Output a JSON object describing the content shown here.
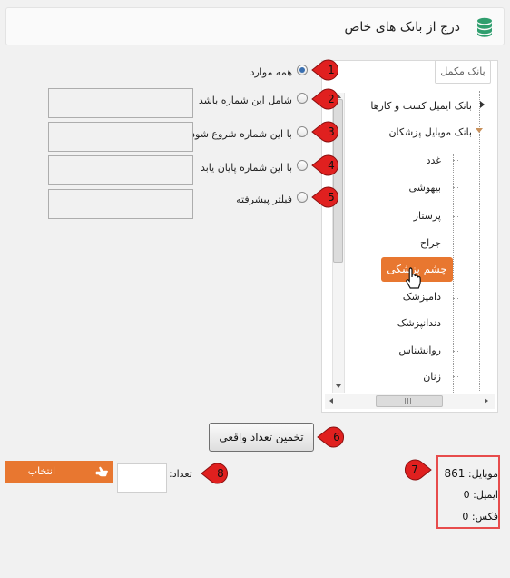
{
  "header": {
    "title": "درج از بانک های خاص",
    "icon": "database-icon"
  },
  "tree": {
    "legend": "بانک مکمل",
    "root_items": [
      {
        "label": "بانک ایمیل کسب و کارها",
        "expanded": false
      },
      {
        "label": "بانک موبایل پزشکان",
        "expanded": true
      }
    ],
    "children": [
      "غدد",
      "بیهوشی",
      "پرستار",
      "جراح",
      "چشم پزشکی",
      "دامپزشک",
      "دندانپزشک",
      "روانشناس",
      "زنان"
    ],
    "selected": "چشم پزشکی"
  },
  "options": [
    {
      "label": "همه موارد",
      "checked": true,
      "badge": "1"
    },
    {
      "label": "شامل این شماره باشد",
      "checked": false,
      "badge": "2"
    },
    {
      "label": "با این شماره شروع شود",
      "checked": false,
      "badge": "3"
    },
    {
      "label": "با این شماره پایان یابد",
      "checked": false,
      "badge": "4"
    },
    {
      "label": "فیلتر پیشرفته",
      "checked": false,
      "badge": "5"
    }
  ],
  "estimate": {
    "label": "تخمین تعداد واقعی",
    "badge": "6"
  },
  "results": {
    "badge": "7",
    "mobile_label": "موبایل:",
    "mobile_value": "861",
    "email_label": "ایمیل:",
    "email_value": "0",
    "fax_label": "فکس:",
    "fax_value": "0"
  },
  "count": {
    "label": "تعداد:",
    "badge": "8",
    "value": ""
  },
  "select_button": {
    "label": "انتخاب",
    "icon": "pointing-hand-icon"
  },
  "colors": {
    "accent": "#e87730",
    "badge_red": "#e0201f",
    "result_border": "#e74c4c",
    "radio_dot": "#3a6fb0"
  }
}
